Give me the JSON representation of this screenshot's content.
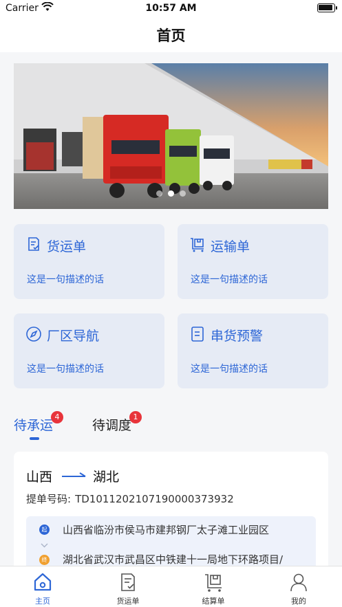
{
  "status_bar": {
    "carrier": "Carrier",
    "time": "10:57 AM"
  },
  "nav": {
    "title": "首页"
  },
  "banner": {
    "slides": 3,
    "active_index": 1
  },
  "cards": [
    {
      "title": "货运单",
      "desc": "这是一句描述的话",
      "icon": "document-icon"
    },
    {
      "title": "运输单",
      "desc": "这是一句描述的话",
      "icon": "cart-icon"
    },
    {
      "title": "厂区导航",
      "desc": "这是一句描述的话",
      "icon": "compass-icon"
    },
    {
      "title": "串货预警",
      "desc": "这是一句描述的话",
      "icon": "warning-doc-icon"
    }
  ],
  "tabs": [
    {
      "label": "待承运",
      "badge": "4",
      "active": true
    },
    {
      "label": "待调度",
      "badge": "1",
      "active": false
    }
  ],
  "order": {
    "from": "山西",
    "to": "湖北",
    "bill_label": "提单号码:",
    "bill_number": "TD10112021071900003739 32",
    "bill_text": "提单号码：TD101120210719000037 3932",
    "start_pin": "起",
    "end_pin": "终",
    "start_address": "山西省临汾市侯马市建邦钢厂太子滩工业园区",
    "end_address": "湖北省武汉市武昌区中铁建十一局地下环路项目/"
  },
  "tab_bar": [
    {
      "label": "主页",
      "active": true,
      "icon": "home-icon"
    },
    {
      "label": "货运单",
      "active": false,
      "icon": "document-icon"
    },
    {
      "label": "结算单",
      "active": false,
      "icon": "cart-icon"
    },
    {
      "label": "我的",
      "active": false,
      "icon": "user-icon"
    }
  ],
  "colors": {
    "accent": "#2d66d6",
    "card_bg": "#e6ebf5",
    "badge": "#e8343b"
  }
}
